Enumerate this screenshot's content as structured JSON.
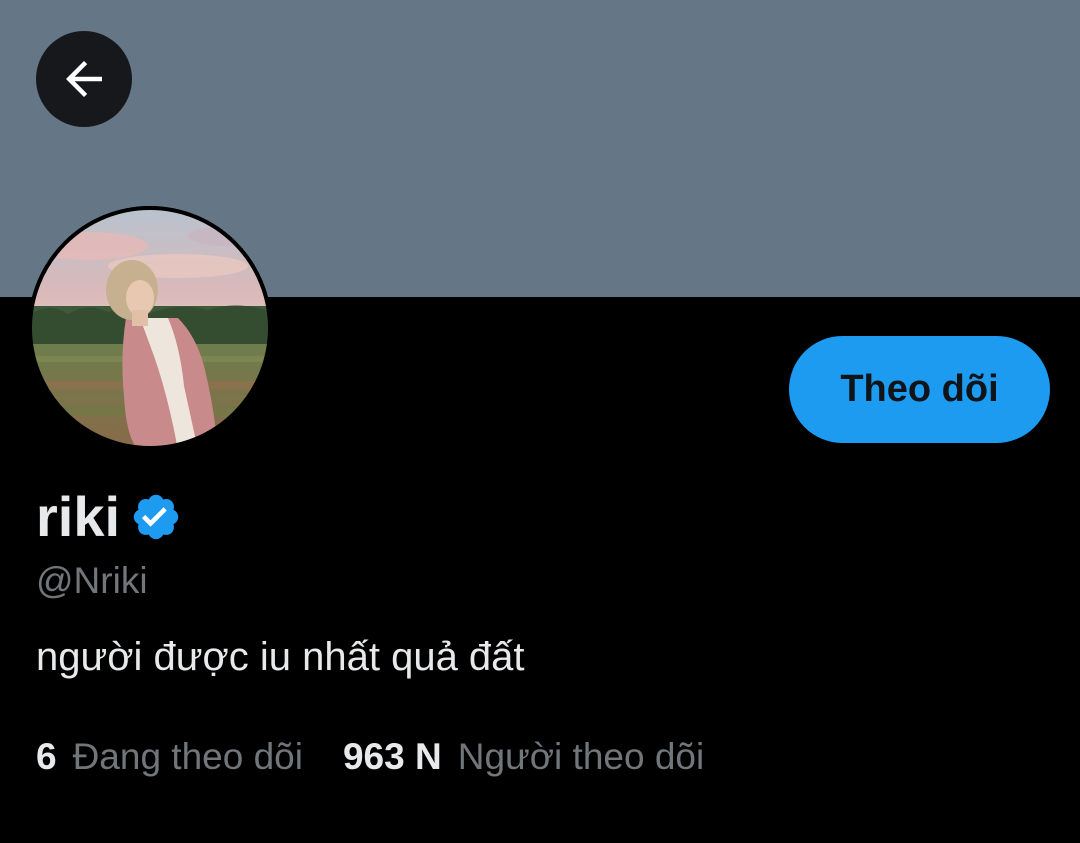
{
  "header": {
    "banner_color": "#657786",
    "back_icon": "arrow-left-icon"
  },
  "profile": {
    "display_name": "riki",
    "verified_icon": "verified-badge-icon",
    "verified_color": "#1d9bf0",
    "handle": "@Nriki",
    "bio": "người được iu nhất quả đất",
    "follow_button_label": "Theo dõi"
  },
  "stats": {
    "following_count": "6",
    "following_label": "Đang theo dõi",
    "followers_count": "963 N",
    "followers_label": "Người theo dõi"
  },
  "colors": {
    "accent": "#1d9bf0",
    "background": "#000000",
    "text_primary": "#e7e9ea",
    "text_secondary": "#71767b"
  }
}
